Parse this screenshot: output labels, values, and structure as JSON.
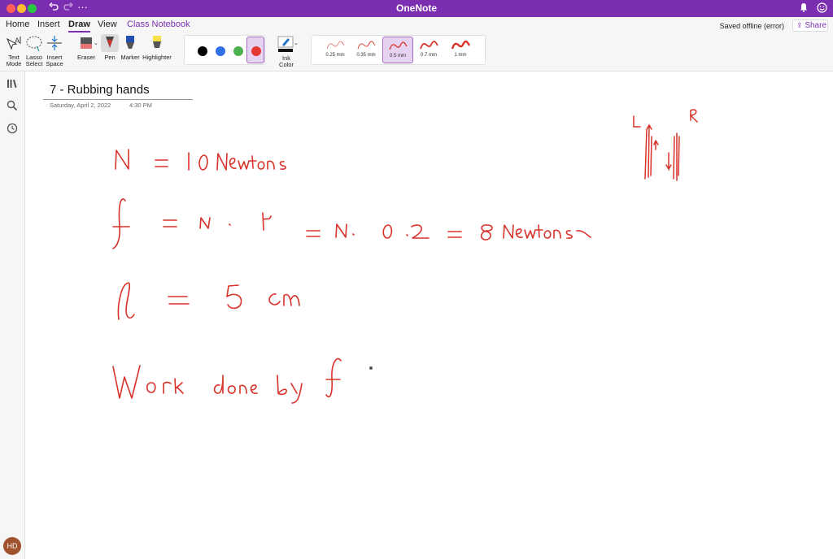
{
  "window": {
    "title": "OneNote"
  },
  "title_bar": {
    "undo_icon": "undo-icon",
    "redo_icon": "redo-icon",
    "more": "···"
  },
  "tabs": [
    {
      "label": "Home"
    },
    {
      "label": "Insert"
    },
    {
      "label": "Draw",
      "active": true
    },
    {
      "label": "View"
    },
    {
      "label": "Class Notebook"
    }
  ],
  "status": {
    "saved": "Saved offline (error)",
    "share_label": "Share"
  },
  "ribbon": {
    "text_mode": "Text\nMode",
    "lasso_select": "Lasso\nSelect",
    "insert_space": "Insert\nSpace",
    "eraser": "Eraser",
    "pen": "Pen",
    "marker": "Marker",
    "highlighter": "Highlighter",
    "ink_color": "Ink\nColor",
    "colors": [
      "#000000",
      "#2f6fe8",
      "#4caf50",
      "#e53935"
    ],
    "selected_color": "#e53935",
    "widths": [
      "0.25 mm",
      "0.35 mm",
      "0.5 mm",
      "0.7 mm",
      "1 mm"
    ],
    "selected_width": "0.5 mm"
  },
  "sidebar": {
    "icons": [
      "notebooks-icon",
      "search-icon",
      "recent-icon"
    ],
    "avatar": "HD"
  },
  "page": {
    "title": "7 - Rubbing hands",
    "date": "Saturday, April 2, 2022",
    "time": "4:30 PM"
  },
  "ink": {
    "color": "#d8322a",
    "line1": "N = 10 Newtons",
    "line2": "f = N · μ = N. 0.2 = 8 Newtons",
    "line3": "l = 5 cm",
    "line4": "Work done by f",
    "diagram_labels": [
      "L",
      "R"
    ]
  }
}
